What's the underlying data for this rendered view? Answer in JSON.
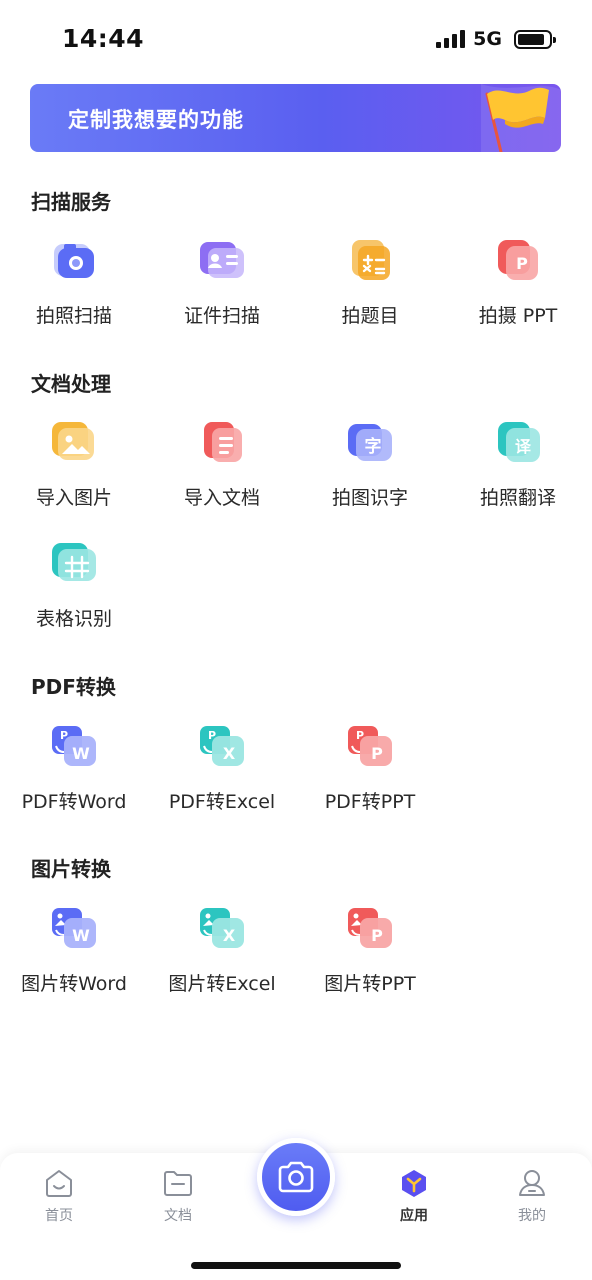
{
  "status_bar": {
    "time": "14:44",
    "network": "5G"
  },
  "banner": {
    "title": "定制我想要的功能"
  },
  "sections": [
    {
      "title": "扫描服务",
      "items": [
        {
          "label": "拍照扫描",
          "icon": "camera-scan-icon",
          "color": "#5b6cf5"
        },
        {
          "label": "证件扫描",
          "icon": "id-card-icon",
          "color": "#7b5cf0"
        },
        {
          "label": "拍题目",
          "icon": "calculator-icon",
          "color": "#f5a623"
        },
        {
          "label": "拍摄 PPT",
          "icon": "ppt-icon",
          "color": "#f05a5a"
        }
      ]
    },
    {
      "title": "文档处理",
      "items": [
        {
          "label": "导入图片",
          "icon": "image-import-icon",
          "color": "#f5b73a"
        },
        {
          "label": "导入文档",
          "icon": "document-import-icon",
          "color": "#f05a5a"
        },
        {
          "label": "拍图识字",
          "icon": "text-recognition-icon",
          "color": "#5b6cf5"
        },
        {
          "label": "拍照翻译",
          "icon": "translate-icon",
          "color": "#2cc5c0"
        },
        {
          "label": "表格识别",
          "icon": "table-recognition-icon",
          "color": "#2cc5c0"
        }
      ]
    },
    {
      "title": "PDF转换",
      "items": [
        {
          "label": "PDF转Word",
          "icon": "pdf-to-word-icon",
          "color": "#5b6cf5"
        },
        {
          "label": "PDF转Excel",
          "icon": "pdf-to-excel-icon",
          "color": "#2cc5c0"
        },
        {
          "label": "PDF转PPT",
          "icon": "pdf-to-ppt-icon",
          "color": "#f05a5a"
        }
      ]
    },
    {
      "title": "图片转换",
      "items": [
        {
          "label": "图片转Word",
          "icon": "image-to-word-icon",
          "color": "#5b6cf5"
        },
        {
          "label": "图片转Excel",
          "icon": "image-to-excel-icon",
          "color": "#2cc5c0"
        },
        {
          "label": "图片转PPT",
          "icon": "image-to-ppt-icon",
          "color": "#f05a5a"
        }
      ]
    }
  ],
  "bottom_nav": {
    "items": [
      {
        "label": "首页",
        "icon": "home-icon"
      },
      {
        "label": "文档",
        "icon": "folder-icon"
      },
      {
        "label": "应用",
        "icon": "apps-icon",
        "active": true
      },
      {
        "label": "我的",
        "icon": "profile-icon"
      }
    ],
    "camera": {
      "icon": "camera-icon"
    }
  }
}
